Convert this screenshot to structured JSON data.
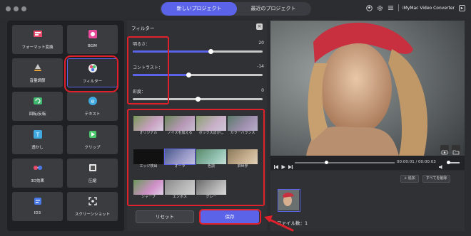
{
  "tabs": {
    "active": "新しいプロジェクト",
    "inactive": "最近のプロジェクト"
  },
  "app_title": "iMyMac Video Converter",
  "tools": [
    {
      "label": "フォーマット変換",
      "icon": "convert-icon"
    },
    {
      "label": "BGM",
      "icon": "music-icon"
    },
    {
      "label": "音量調節",
      "icon": "volume-icon"
    },
    {
      "label": "フィルター",
      "icon": "filter-icon"
    },
    {
      "label": "回転/反転",
      "icon": "rotate-icon"
    },
    {
      "label": "テキスト",
      "icon": "text-icon"
    },
    {
      "label": "透かし",
      "icon": "watermark-icon"
    },
    {
      "label": "クリップ",
      "icon": "clip-icon"
    },
    {
      "label": "3D効果",
      "icon": "3d-glasses-icon"
    },
    {
      "label": "圧縮",
      "icon": "compress-icon"
    },
    {
      "label": "ID3",
      "icon": "id3-icon"
    },
    {
      "label": "スクリーンショット",
      "icon": "screenshot-icon"
    }
  ],
  "filter": {
    "title": "フィルター",
    "brightness_label": "明るさ：",
    "brightness_value": "20",
    "brightness_fraction": 0.6,
    "contrast_label": "コントラスト：",
    "contrast_value": "-14",
    "contrast_fraction": 0.43,
    "saturation_label": "彩度：",
    "saturation_value": "0",
    "saturation_fraction": 0.5,
    "presets": [
      "オリジナル",
      "ノイズを加える",
      "ボックスぼかし",
      "カラーバランス",
      "エッジ検出",
      "オーラ",
      "色調",
      "旧世界",
      "シャープ",
      "エンボス",
      "グレー"
    ],
    "reset_label": "リセット",
    "save_label": "保存"
  },
  "player": {
    "time": "00:00:01 / 00:00:03"
  },
  "files": {
    "add_label": "+ 追加",
    "remove_all_label": "すべてを削除",
    "count_label": "ファイル数：1"
  },
  "colors": {
    "accent": "#5b64e8",
    "highlight": "#e0212b"
  }
}
